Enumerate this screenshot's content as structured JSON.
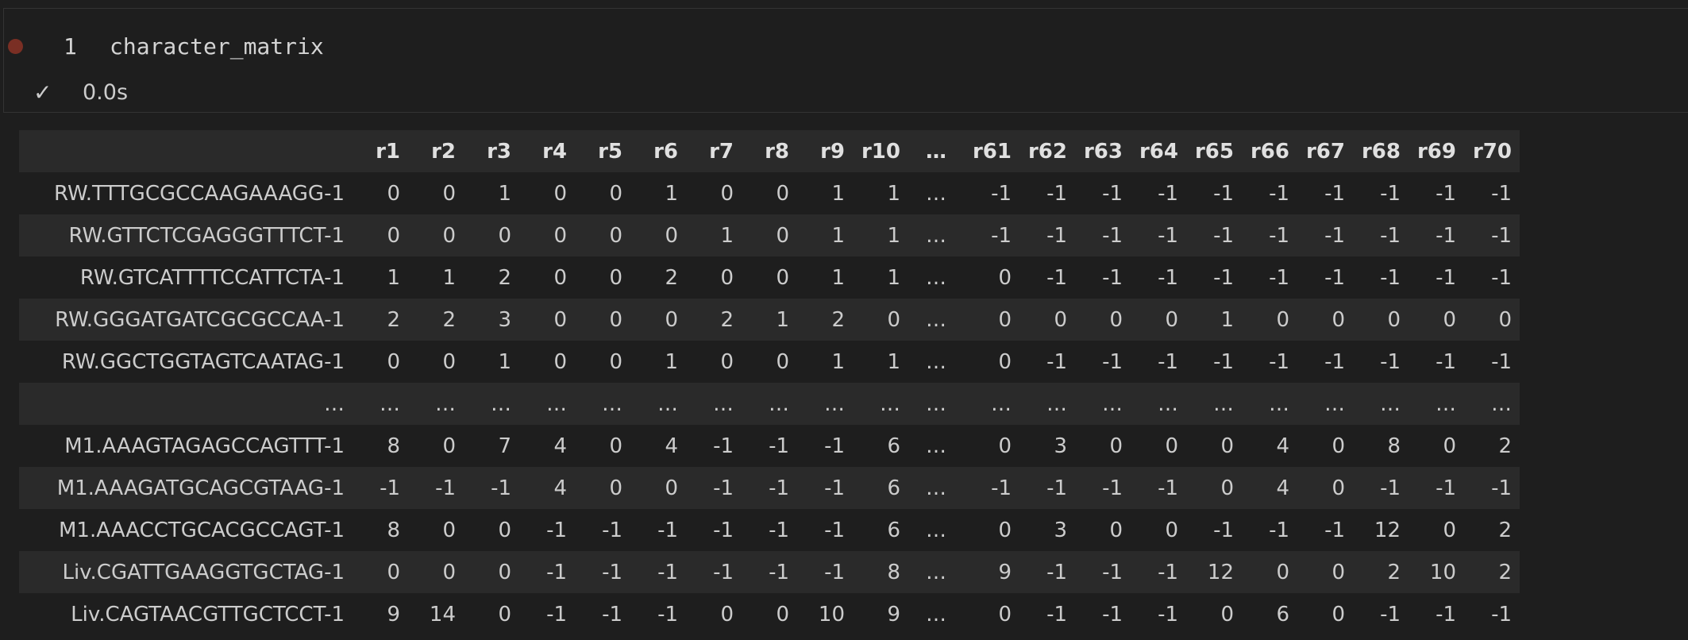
{
  "cell": {
    "line_number": "1",
    "code": "character_matrix",
    "status_icon": "checkmark-icon",
    "exec_time": "0.0s"
  },
  "table": {
    "columns": [
      "r1",
      "r2",
      "r3",
      "r4",
      "r5",
      "r6",
      "r7",
      "r8",
      "r9",
      "r10",
      "…",
      "r61",
      "r62",
      "r63",
      "r64",
      "r65",
      "r66",
      "r67",
      "r68",
      "r69",
      "r70"
    ],
    "rows": [
      {
        "index": "RW.TTTGCGCCAAGAAAGG-1",
        "values": [
          "0",
          "0",
          "1",
          "0",
          "0",
          "1",
          "0",
          "0",
          "1",
          "1",
          "…",
          "-1",
          "-1",
          "-1",
          "-1",
          "-1",
          "-1",
          "-1",
          "-1",
          "-1",
          "-1"
        ]
      },
      {
        "index": "RW.GTTCTCGAGGGTTTCT-1",
        "values": [
          "0",
          "0",
          "0",
          "0",
          "0",
          "0",
          "1",
          "0",
          "1",
          "1",
          "…",
          "-1",
          "-1",
          "-1",
          "-1",
          "-1",
          "-1",
          "-1",
          "-1",
          "-1",
          "-1"
        ]
      },
      {
        "index": "RW.GTCATTTTCCATTCTA-1",
        "values": [
          "1",
          "1",
          "2",
          "0",
          "0",
          "2",
          "0",
          "0",
          "1",
          "1",
          "…",
          "0",
          "-1",
          "-1",
          "-1",
          "-1",
          "-1",
          "-1",
          "-1",
          "-1",
          "-1"
        ]
      },
      {
        "index": "RW.GGGATGATCGCGCCAA-1",
        "values": [
          "2",
          "2",
          "3",
          "0",
          "0",
          "0",
          "2",
          "1",
          "2",
          "0",
          "…",
          "0",
          "0",
          "0",
          "0",
          "1",
          "0",
          "0",
          "0",
          "0",
          "0"
        ]
      },
      {
        "index": "RW.GGCTGGTAGTCAATAG-1",
        "values": [
          "0",
          "0",
          "1",
          "0",
          "0",
          "1",
          "0",
          "0",
          "1",
          "1",
          "…",
          "0",
          "-1",
          "-1",
          "-1",
          "-1",
          "-1",
          "-1",
          "-1",
          "-1",
          "-1"
        ]
      },
      {
        "index": "…",
        "values": [
          "…",
          "…",
          "…",
          "…",
          "…",
          "…",
          "…",
          "…",
          "…",
          "…",
          "…",
          "…",
          "…",
          "…",
          "…",
          "…",
          "…",
          "…",
          "…",
          "…",
          "…"
        ]
      },
      {
        "index": "M1.AAAGTAGAGCCAGTTT-1",
        "values": [
          "8",
          "0",
          "7",
          "4",
          "0",
          "4",
          "-1",
          "-1",
          "-1",
          "6",
          "…",
          "0",
          "3",
          "0",
          "0",
          "0",
          "4",
          "0",
          "8",
          "0",
          "2"
        ]
      },
      {
        "index": "M1.AAAGATGCAGCGTAAG-1",
        "values": [
          "-1",
          "-1",
          "-1",
          "4",
          "0",
          "0",
          "-1",
          "-1",
          "-1",
          "6",
          "…",
          "-1",
          "-1",
          "-1",
          "-1",
          "0",
          "4",
          "0",
          "-1",
          "-1",
          "-1"
        ]
      },
      {
        "index": "M1.AAACCTGCACGCCAGT-1",
        "values": [
          "8",
          "0",
          "0",
          "-1",
          "-1",
          "-1",
          "-1",
          "-1",
          "-1",
          "6",
          "…",
          "0",
          "3",
          "0",
          "0",
          "-1",
          "-1",
          "-1",
          "12",
          "0",
          "2"
        ]
      },
      {
        "index": "Liv.CGATTGAAGGTGCTAG-1",
        "values": [
          "0",
          "0",
          "0",
          "-1",
          "-1",
          "-1",
          "-1",
          "-1",
          "-1",
          "8",
          "…",
          "9",
          "-1",
          "-1",
          "-1",
          "12",
          "0",
          "0",
          "2",
          "10",
          "2"
        ]
      },
      {
        "index": "Liv.CAGTAACGTTGCTCCT-1",
        "values": [
          "9",
          "14",
          "0",
          "-1",
          "-1",
          "-1",
          "0",
          "0",
          "10",
          "9",
          "…",
          "0",
          "-1",
          "-1",
          "-1",
          "0",
          "6",
          "0",
          "-1",
          "-1",
          "-1"
        ]
      }
    ]
  }
}
